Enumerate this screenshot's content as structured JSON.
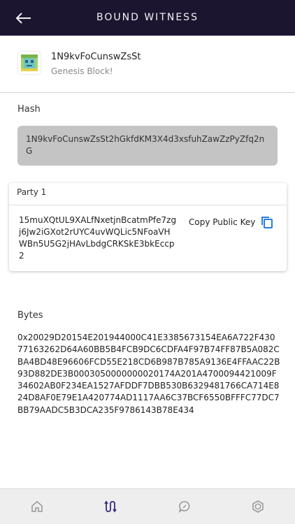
{
  "header": {
    "title": "BOUND WITNESS"
  },
  "block": {
    "title": "1N9kvFoCunswZsSt",
    "subtitle": "Genesis Block!"
  },
  "hash": {
    "label": "Hash",
    "value": "1N9kvFoCunswZsSt2hGkfdKM3X4d3xsfuhZawZzPyZfq2nG"
  },
  "party": {
    "title": "Party 1",
    "public_key": "15muXQtUL9XALfNxetjnBcatmPfe7zgj6Jw2iGXot2rUYC4uvWQLic5NFoaVHWBn5U5G2jHAvLbdgCRKSkE3bkEccp2",
    "copy_label": "Copy Public Key"
  },
  "bytes": {
    "label": "Bytes",
    "value": "0x20029D20154E201944000C41E3385673154EA6A722F43077163262D64A60BB5B4FCB9DC6CDFA4F97B74FF87B5A082CBA4BD48E96606FCD55E218CD6B987B785A9136E4FFAAC22B93D882DE3B0003050000000020174A201A4700094421009F34602AB0F234EA1527AFDDF7DBB530B6329481766CA714E824D8AF0E79E1A420774AD1117AA6C37BCF6550BFFFC77DC7BB79AADC5B3DCA235F9786143B78E434"
  },
  "colors": {
    "topbar": "#1c1530",
    "accent": "#2a7de1",
    "tab_active": "#3b2a80",
    "tab_inactive": "#9a9a9a"
  },
  "tabs": [
    {
      "icon": "home-icon"
    },
    {
      "icon": "bound-witness-icon"
    },
    {
      "icon": "chat-icon"
    },
    {
      "icon": "hexagon-icon"
    }
  ]
}
